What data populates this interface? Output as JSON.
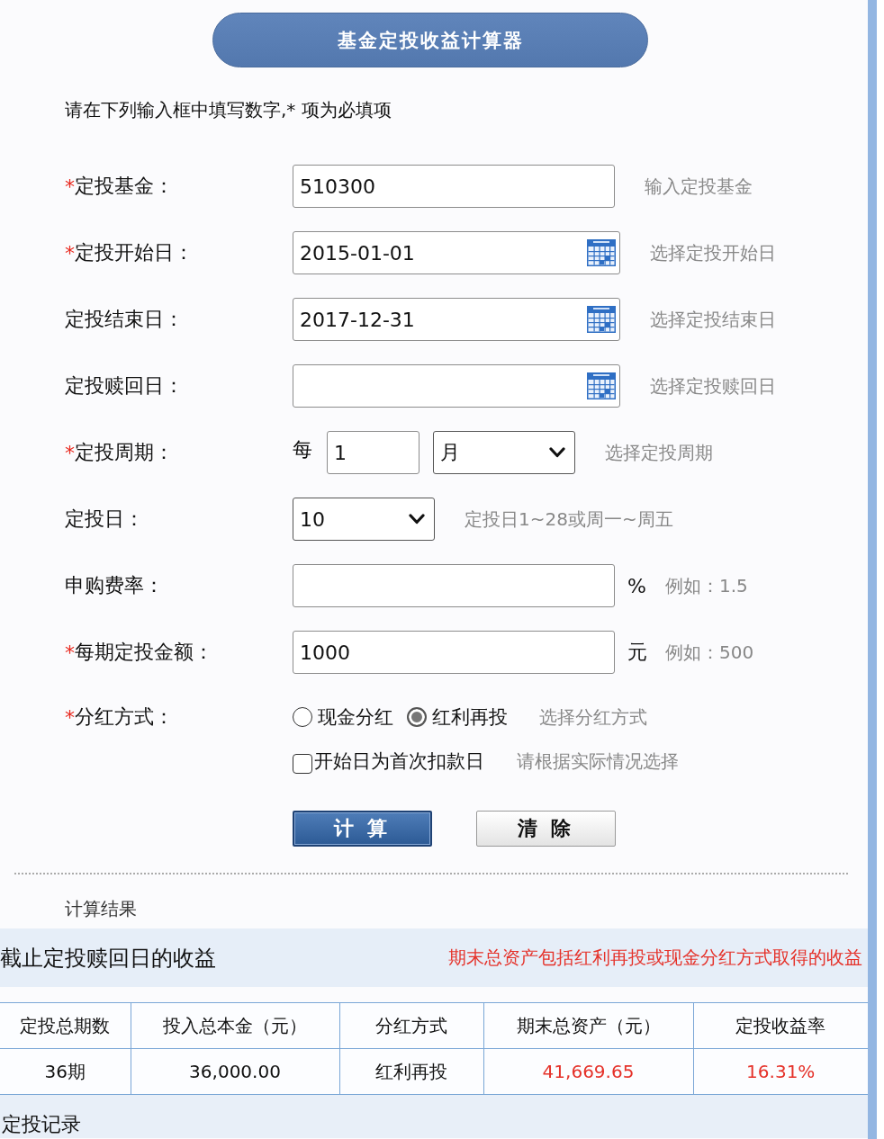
{
  "header": {
    "title": "基金定投收益计算器"
  },
  "instructions": "请在下列输入框中填写数字,* 项为必填项",
  "form": {
    "rows": [
      {
        "kind": "text",
        "mark": "*",
        "label": "定投基金：",
        "value": "510300",
        "hint": "输入定投基金"
      },
      {
        "kind": "date",
        "mark": "*",
        "label": "定投开始日：",
        "value": "2015-01-01",
        "hint": "选择定投开始日"
      },
      {
        "kind": "date",
        "label": "定投结束日：",
        "value": "2017-12-31",
        "hint": "选择定投结束日"
      },
      {
        "kind": "date",
        "label": "定投赎回日：",
        "hint": "选择定投赎回日"
      },
      {
        "kind": "period",
        "mark": "*",
        "label": "定投周期：",
        "prefix": "每",
        "value": "1",
        "unit": "月",
        "hint": "选择定投周期"
      },
      {
        "kind": "select",
        "label": "定投日：",
        "value": "10",
        "hint": "定投日1~28或周一~周五"
      },
      {
        "kind": "text",
        "label": "申购费率：",
        "suffix": "%",
        "hint": "例如：1.5"
      },
      {
        "kind": "text",
        "mark": "*",
        "label": "每期定投金额：",
        "value": "1000",
        "suffix": "元",
        "hint": "例如：500"
      },
      {
        "kind": "radio",
        "mark": "*",
        "label": "分红方式：",
        "options": [
          {
            "label": "现金分红",
            "selected": false
          },
          {
            "label": "红利再投",
            "selected": true
          }
        ],
        "hint": "选择分红方式"
      },
      {
        "kind": "checkbox",
        "text": "开始日为首次扣款日",
        "checked": false,
        "hint": "请根据实际情况选择"
      }
    ],
    "buttons": [
      {
        "kind": "primary",
        "label": "计 算"
      },
      {
        "kind": "secondary",
        "label": "清 除"
      }
    ]
  },
  "results": {
    "title": "计算结果",
    "heading": "截止定投赎回日的收益",
    "note": "期末总资产包括红利再投或现金分红方式取得的收益",
    "table": {
      "columns": [
        "定投总期数",
        "投入总本金（元）",
        "分红方式",
        "期末总资产（元）",
        "定投收益率"
      ],
      "rows": [
        {
          "cells": [
            {
              "text": "36期",
              "emphasis": false
            },
            {
              "text": "36,000.00",
              "emphasis": false
            },
            {
              "text": "红利再投",
              "emphasis": false
            },
            {
              "text": "41,669.65",
              "emphasis": true
            },
            {
              "text": "16.31%",
              "emphasis": true
            }
          ]
        }
      ]
    }
  },
  "records": {
    "title": "定投记录"
  }
}
